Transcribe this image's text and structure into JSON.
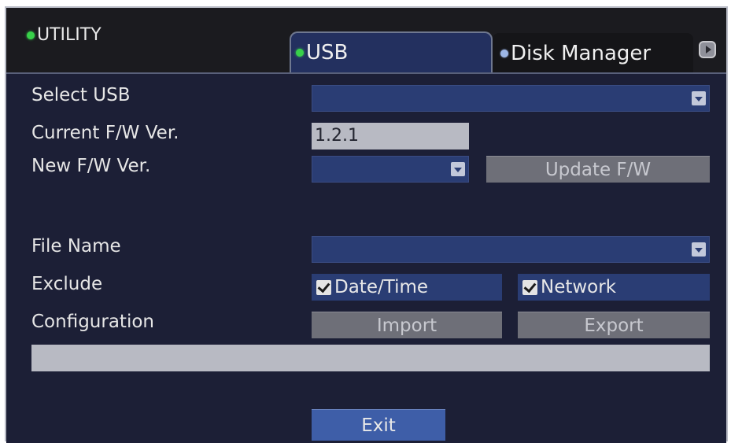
{
  "header": {
    "title": "UTILITY",
    "tabs": [
      {
        "label": "USB",
        "active": true,
        "indicator": "green"
      },
      {
        "label": "Disk Manager",
        "active": false,
        "indicator": "blue"
      }
    ],
    "next_icon": "chevron-right-icon"
  },
  "form": {
    "select_usb": {
      "label": "Select USB",
      "value": ""
    },
    "current_fw": {
      "label": "Current F/W Ver.",
      "value": "1.2.1"
    },
    "new_fw": {
      "label": "New F/W Ver.",
      "value": "",
      "button": "Update F/W"
    },
    "file_name": {
      "label": "File Name",
      "value": ""
    },
    "exclude": {
      "label": "Exclude",
      "options": [
        {
          "label": "Date/Time",
          "checked": true
        },
        {
          "label": "Network",
          "checked": true
        }
      ]
    },
    "configuration": {
      "label": "Configuration",
      "import": "Import",
      "export": "Export"
    }
  },
  "progress": {
    "value": 0
  },
  "footer": {
    "exit": "Exit"
  },
  "colors": {
    "accent_green": "#38d14a",
    "panel": "#1c1f36",
    "control": "#2a3d74"
  }
}
